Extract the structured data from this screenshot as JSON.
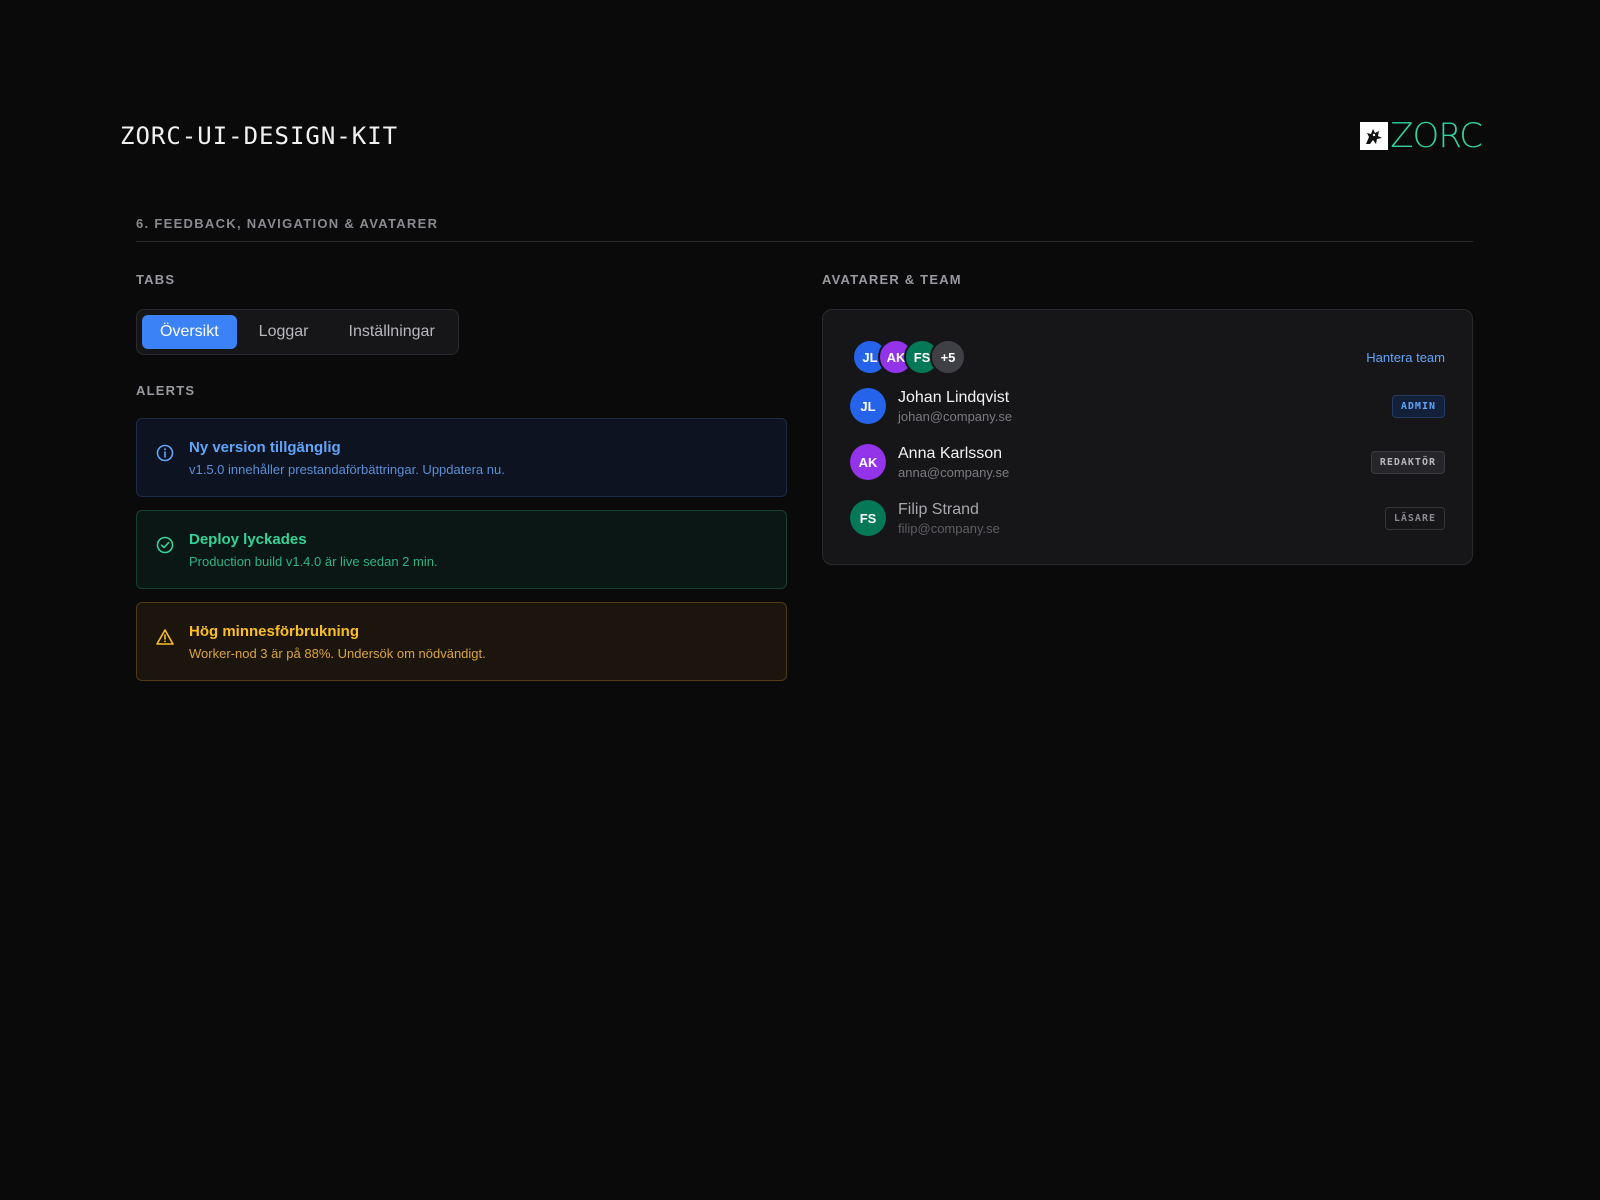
{
  "header": {
    "title": "ZORC-UI-DESIGN-KIT",
    "logo_text": "ZORC",
    "logo_color": "#2fd4a0"
  },
  "section": {
    "title": "6. FEEDBACK, NAVIGATION & AVATARER"
  },
  "tabs": {
    "label": "TABS",
    "items": [
      {
        "label": "Översikt",
        "active": true
      },
      {
        "label": "Loggar",
        "active": false
      },
      {
        "label": "Inställningar",
        "active": false
      }
    ],
    "active_color": "#3b82f6"
  },
  "alerts": {
    "label": "ALERTS",
    "items": [
      {
        "type": "info",
        "icon": "info-icon",
        "title": "Ny version tillgänglig",
        "body": "v1.5.0 innehåller prestandaförbättringar. Uppdatera nu.",
        "color": "#60a5fa"
      },
      {
        "type": "success",
        "icon": "check-circle-icon",
        "title": "Deploy lyckades",
        "body": "Production build v1.4.0 är live sedan 2 min.",
        "color": "#34d399"
      },
      {
        "type": "warn",
        "icon": "warning-icon",
        "title": "Hög minnesförbrukning",
        "body": "Worker-nod 3 är på 88%. Undersök om nödvändigt.",
        "color": "#fbbf24"
      }
    ]
  },
  "team": {
    "label": "AVATARER & TEAM",
    "manage_link": "Hantera team",
    "stack": [
      {
        "initials": "JL",
        "color": "#2563eb"
      },
      {
        "initials": "AK",
        "color": "#9333ea"
      },
      {
        "initials": "FS",
        "color": "#047857"
      },
      {
        "initials": "+5",
        "color": "#3f3f46"
      }
    ],
    "members": [
      {
        "initials": "JL",
        "color": "#2563eb",
        "name": "Johan Lindqvist",
        "email": "johan@company.se",
        "role": "ADMIN",
        "role_type": "admin"
      },
      {
        "initials": "AK",
        "color": "#9333ea",
        "name": "Anna Karlsson",
        "email": "anna@company.se",
        "role": "REDAKTÖR",
        "role_type": "editor"
      },
      {
        "initials": "FS",
        "color": "#047857",
        "name": "Filip Strand",
        "email": "filip@company.se",
        "role": "LÄSARE",
        "role_type": "reader"
      }
    ]
  }
}
